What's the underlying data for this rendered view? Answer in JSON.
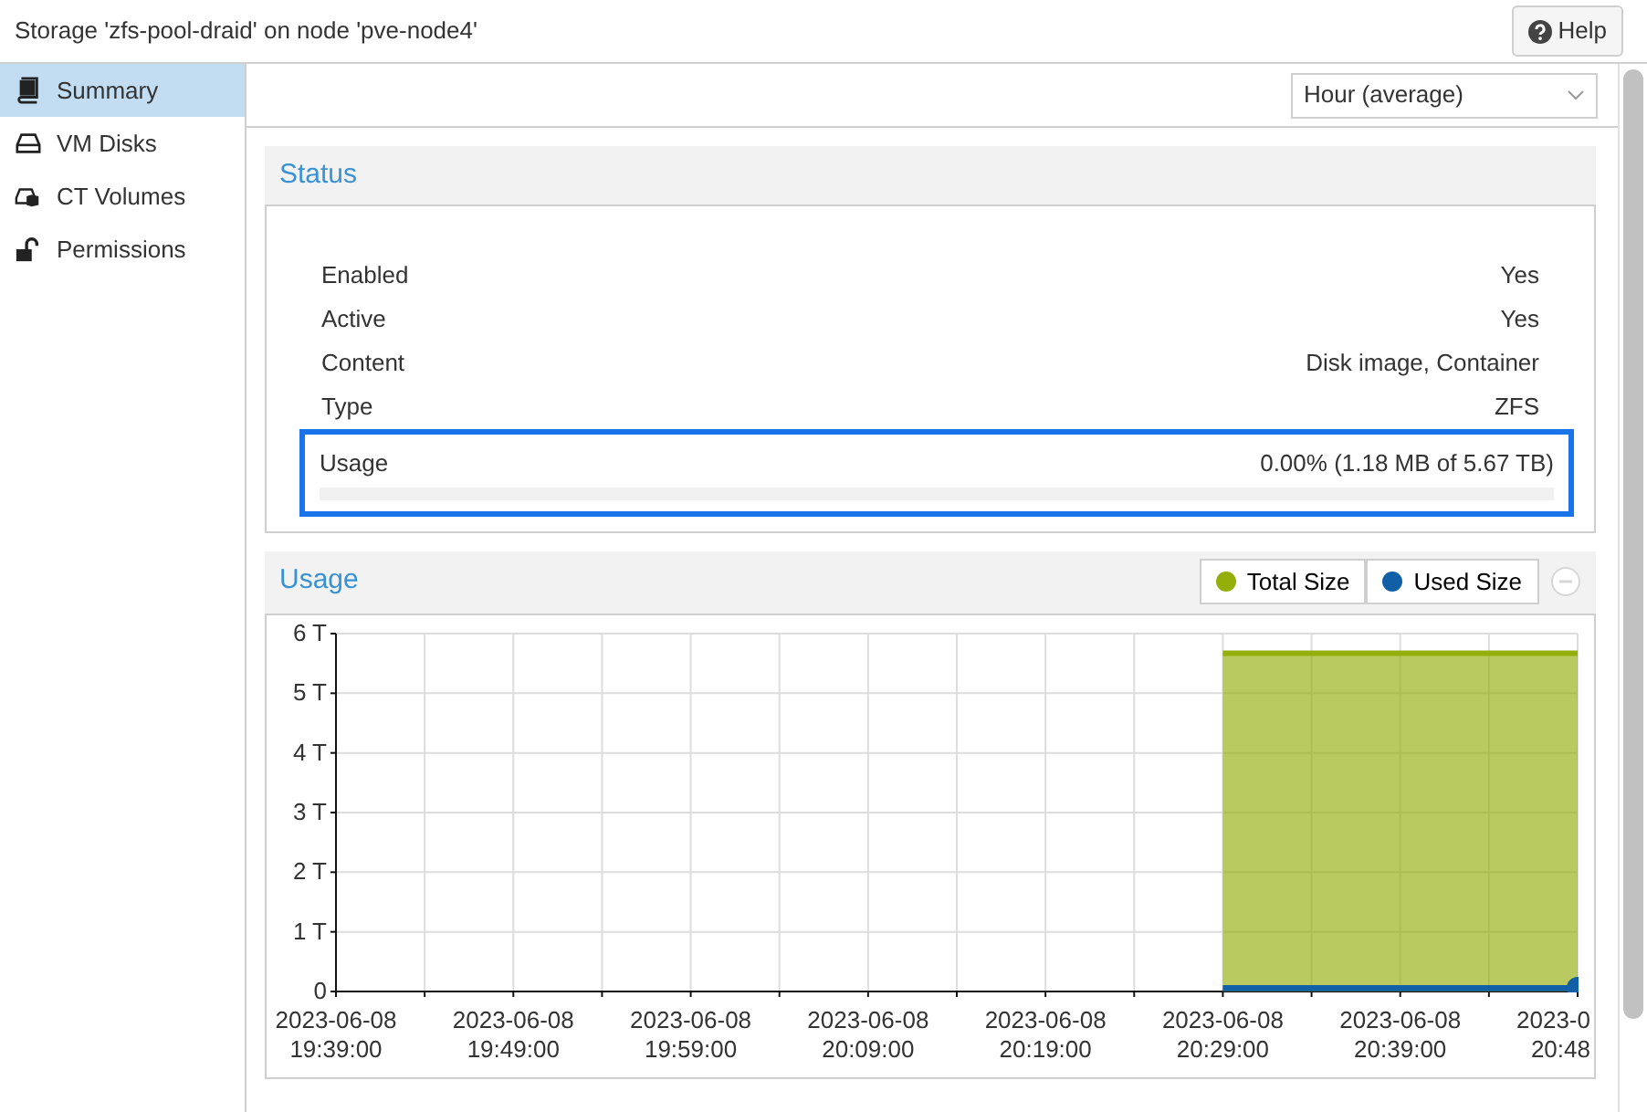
{
  "window": {
    "title": "Storage 'zfs-pool-draid' on node 'pve-node4'"
  },
  "help_button": {
    "label": "Help"
  },
  "sidebar": {
    "items": [
      {
        "label": "Summary",
        "selected": true
      },
      {
        "label": "VM Disks",
        "selected": false
      },
      {
        "label": "CT Volumes",
        "selected": false
      },
      {
        "label": "Permissions",
        "selected": false
      }
    ]
  },
  "timeframe": {
    "value": "Hour (average)"
  },
  "status_panel": {
    "title": "Status",
    "rows": [
      {
        "kind": "text",
        "label": "Enabled",
        "value": "Yes"
      },
      {
        "kind": "text",
        "label": "Active",
        "value": "Yes"
      },
      {
        "kind": "text",
        "label": "Content",
        "value": "Disk image, Container"
      },
      {
        "kind": "text",
        "label": "Type",
        "value": "ZFS"
      },
      {
        "kind": "progress",
        "label": "Usage",
        "value": "0.00% (1.18 MB of 5.67 TB)",
        "level": 0,
        "highlighted": true
      }
    ]
  },
  "usage_panel": {
    "title": "Usage",
    "chart_data": {
      "type": "area",
      "categories": [
        "2023-06-08 19:39:00",
        null,
        "2023-06-08 19:49:00",
        null,
        "2023-06-08 19:59:00",
        null,
        "2023-06-08 20:09:00",
        null,
        "2023-06-08 20:19:00",
        null,
        "2023-06-08 20:29:00",
        null,
        "2023-06-08 20:39:00",
        null,
        "2023-0 20:48"
      ],
      "series": [
        {
          "name": "Total Size",
          "color": "#94ae0a",
          "values": [
            null,
            null,
            null,
            null,
            null,
            null,
            null,
            null,
            null,
            null,
            5.67,
            5.67,
            5.67,
            5.67,
            5.67
          ]
        },
        {
          "name": "Used Size",
          "color": "#115fa6",
          "values": [
            null,
            null,
            null,
            null,
            null,
            null,
            null,
            null,
            null,
            null,
            0,
            0,
            0,
            0,
            0
          ]
        }
      ],
      "ylim": [
        0,
        6
      ],
      "grid": true,
      "yticks": [
        {
          "value": 0,
          "label": "0"
        },
        {
          "value": 1,
          "label": "1 T"
        },
        {
          "value": 2,
          "label": "2 T"
        },
        {
          "value": 3,
          "label": "3 T"
        },
        {
          "value": 4,
          "label": "4 T"
        },
        {
          "value": 5,
          "label": "5 T"
        },
        {
          "value": 6,
          "label": "6 T"
        }
      ]
    }
  }
}
